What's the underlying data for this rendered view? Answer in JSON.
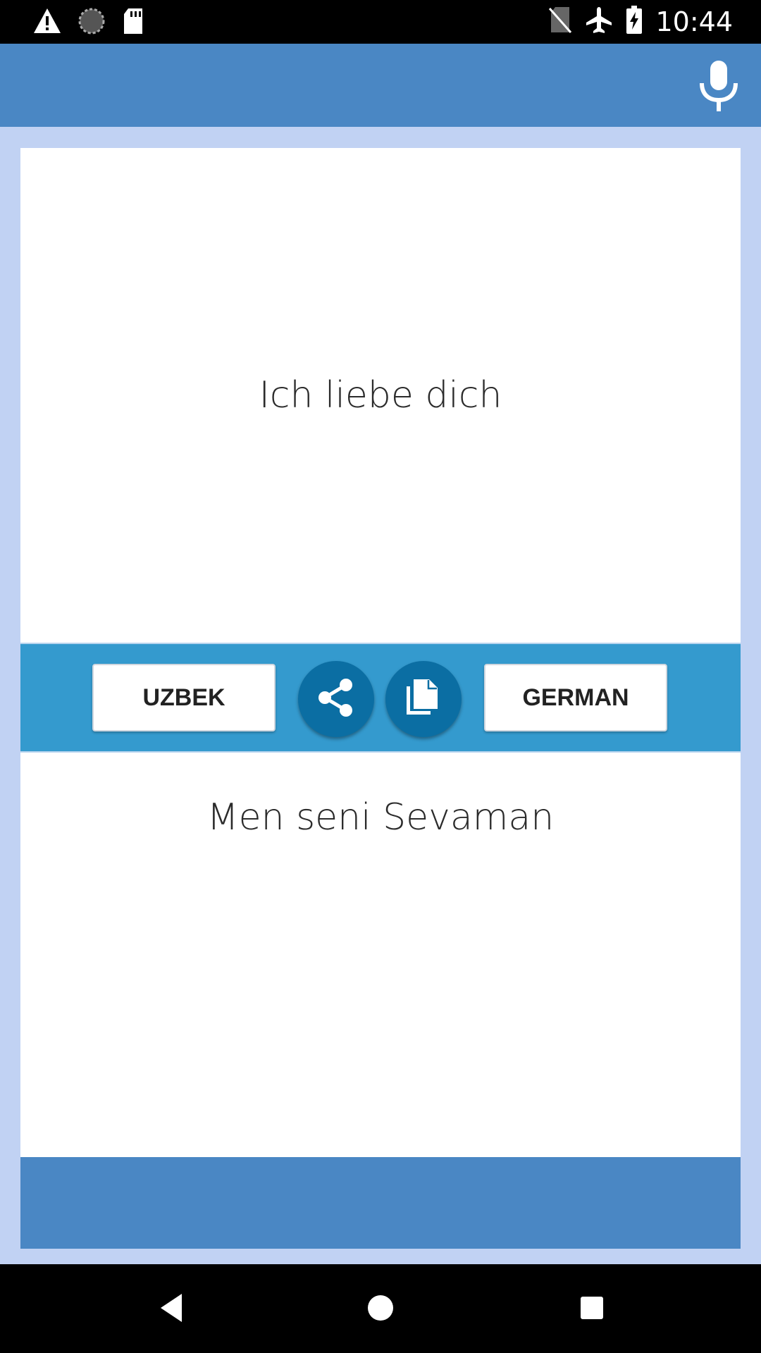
{
  "status_bar": {
    "time": "10:44",
    "icons": [
      "warning-icon",
      "sync-icon",
      "sd-card-icon",
      "no-sim-icon",
      "airplane-icon",
      "battery-charging-icon"
    ]
  },
  "app_bar": {
    "action_icon": "microphone-icon",
    "color": "#4a87c4"
  },
  "source_panel": {
    "text": "Ich liebe dich"
  },
  "toolbar": {
    "source_language": "UZBEK",
    "target_language": "GERMAN",
    "share_icon": "share-icon",
    "copy_icon": "copy-icon",
    "color": "#349ace"
  },
  "result_panel": {
    "text": "Men seni Sevaman"
  },
  "nav_bar": {
    "buttons": [
      "back-icon",
      "home-icon",
      "recents-icon"
    ]
  }
}
